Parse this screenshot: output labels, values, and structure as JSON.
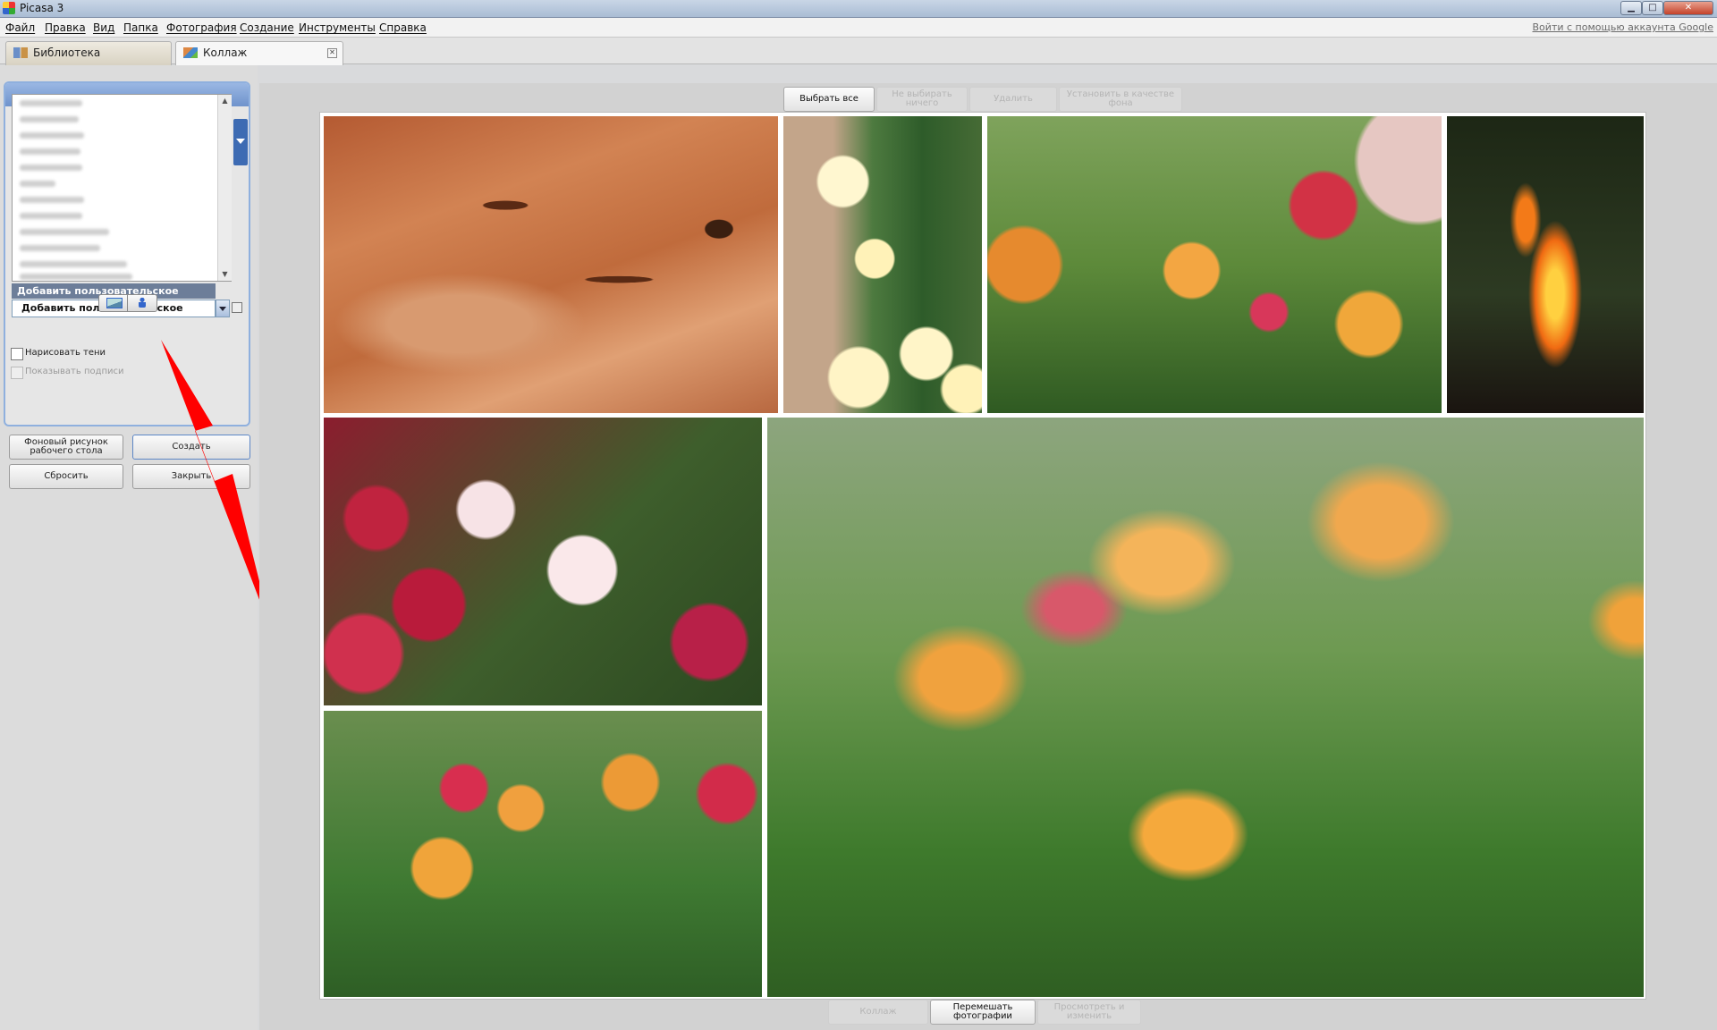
{
  "window": {
    "title": "Picasa 3",
    "minimize_glyph": "▁",
    "maximize_glyph": "□",
    "close_glyph": "✕"
  },
  "menu": {
    "items": [
      "Файл",
      "Правка",
      "Вид",
      "Папка",
      "Фотография",
      "Создание",
      "Инструменты",
      "Справка"
    ],
    "signin": "Войти с помощью аккаунта Google"
  },
  "tabs": [
    {
      "label": "Библиотека",
      "icon": "library-icon"
    },
    {
      "label": "Коллаж",
      "icon": "collage-icon",
      "close_glyph": "✕"
    }
  ],
  "settings": {
    "list_selected": "Добавить пользовательское",
    "combo_value": "Добавить пользовательское",
    "draw_shadows": {
      "label": "Нарисовать тени",
      "checked": false
    },
    "show_captions": {
      "label": "Показывать подписи",
      "checked": false,
      "disabled": true
    },
    "orientation_icons": [
      "landscape-icon",
      "portrait-icon"
    ]
  },
  "panel_buttons": {
    "desktop_bg": "Фоновый рисунок рабочего стола",
    "create": "Создать",
    "reset": "Сбросить",
    "close": "Закрыть"
  },
  "toolbar": {
    "select_all": "Выбрать все",
    "select_none": "Не выбирать ничего",
    "delete": "Удалить",
    "set_background": "Установить в качестве фона"
  },
  "bottom_bar": {
    "collage": "Коллаж",
    "shuffle": "Перемешать фотографии",
    "view_edit": "Просмотреть и изменить"
  },
  "colors": {
    "accent": "#3d6bb3",
    "annotation_arrow": "#ff0000",
    "selection": "#6d7e99"
  }
}
